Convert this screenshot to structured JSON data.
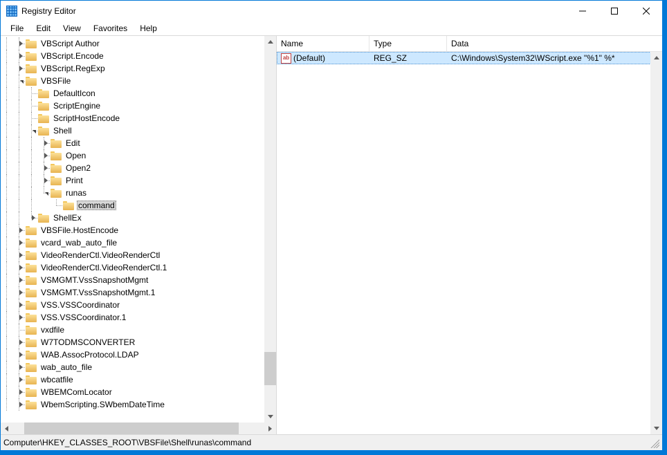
{
  "window": {
    "title": "Registry Editor"
  },
  "menu": {
    "file": "File",
    "edit": "Edit",
    "view": "View",
    "favorites": "Favorites",
    "help": "Help"
  },
  "tree": {
    "items": [
      {
        "label": "VBScript Author",
        "indent": [
          "v",
          "tee"
        ],
        "exp": "closed"
      },
      {
        "label": "VBScript.Encode",
        "indent": [
          "v",
          "tee"
        ],
        "exp": "closed"
      },
      {
        "label": "VBScript.RegExp",
        "indent": [
          "v",
          "tee"
        ],
        "exp": "closed"
      },
      {
        "label": "VBSFile",
        "indent": [
          "v",
          "tee"
        ],
        "exp": "open"
      },
      {
        "label": "DefaultIcon",
        "indent": [
          "v",
          "v",
          "tee"
        ],
        "exp": "none"
      },
      {
        "label": "ScriptEngine",
        "indent": [
          "v",
          "v",
          "tee"
        ],
        "exp": "none"
      },
      {
        "label": "ScriptHostEncode",
        "indent": [
          "v",
          "v",
          "tee"
        ],
        "exp": "none"
      },
      {
        "label": "Shell",
        "indent": [
          "v",
          "v",
          "tee"
        ],
        "exp": "open"
      },
      {
        "label": "Edit",
        "indent": [
          "v",
          "v",
          "v",
          "tee"
        ],
        "exp": "closed"
      },
      {
        "label": "Open",
        "indent": [
          "v",
          "v",
          "v",
          "tee"
        ],
        "exp": "closed"
      },
      {
        "label": "Open2",
        "indent": [
          "v",
          "v",
          "v",
          "tee"
        ],
        "exp": "closed"
      },
      {
        "label": "Print",
        "indent": [
          "v",
          "v",
          "v",
          "tee"
        ],
        "exp": "closed"
      },
      {
        "label": "runas",
        "indent": [
          "v",
          "v",
          "v",
          "ell"
        ],
        "exp": "open"
      },
      {
        "label": "command",
        "indent": [
          "v",
          "v",
          "v",
          "",
          "ell"
        ],
        "exp": "none",
        "selected": true
      },
      {
        "label": "ShellEx",
        "indent": [
          "v",
          "v",
          "ell"
        ],
        "exp": "closed"
      },
      {
        "label": "VBSFile.HostEncode",
        "indent": [
          "v",
          "tee"
        ],
        "exp": "closed"
      },
      {
        "label": "vcard_wab_auto_file",
        "indent": [
          "v",
          "tee"
        ],
        "exp": "closed"
      },
      {
        "label": "VideoRenderCtl.VideoRenderCtl",
        "indent": [
          "v",
          "tee"
        ],
        "exp": "closed"
      },
      {
        "label": "VideoRenderCtl.VideoRenderCtl.1",
        "indent": [
          "v",
          "tee"
        ],
        "exp": "closed"
      },
      {
        "label": "VSMGMT.VssSnapshotMgmt",
        "indent": [
          "v",
          "tee"
        ],
        "exp": "closed"
      },
      {
        "label": "VSMGMT.VssSnapshotMgmt.1",
        "indent": [
          "v",
          "tee"
        ],
        "exp": "closed"
      },
      {
        "label": "VSS.VSSCoordinator",
        "indent": [
          "v",
          "tee"
        ],
        "exp": "closed"
      },
      {
        "label": "VSS.VSSCoordinator.1",
        "indent": [
          "v",
          "tee"
        ],
        "exp": "closed"
      },
      {
        "label": "vxdfile",
        "indent": [
          "v",
          "tee"
        ],
        "exp": "none"
      },
      {
        "label": "W7TODMSCONVERTER",
        "indent": [
          "v",
          "tee"
        ],
        "exp": "closed"
      },
      {
        "label": "WAB.AssocProtocol.LDAP",
        "indent": [
          "v",
          "tee"
        ],
        "exp": "closed"
      },
      {
        "label": "wab_auto_file",
        "indent": [
          "v",
          "tee"
        ],
        "exp": "closed"
      },
      {
        "label": "wbcatfile",
        "indent": [
          "v",
          "tee"
        ],
        "exp": "closed"
      },
      {
        "label": "WBEMComLocator",
        "indent": [
          "v",
          "tee"
        ],
        "exp": "closed"
      },
      {
        "label": "WbemScripting.SWbemDateTime",
        "indent": [
          "v",
          "tee"
        ],
        "exp": "closed"
      }
    ]
  },
  "list": {
    "columns": {
      "name": "Name",
      "type": "Type",
      "data": "Data"
    },
    "rows": [
      {
        "name": "(Default)",
        "type": "REG_SZ",
        "data": "C:\\Windows\\System32\\WScript.exe \"%1\" %*"
      }
    ]
  },
  "statusbar": {
    "path": "Computer\\HKEY_CLASSES_ROOT\\VBSFile\\Shell\\runas\\command"
  }
}
